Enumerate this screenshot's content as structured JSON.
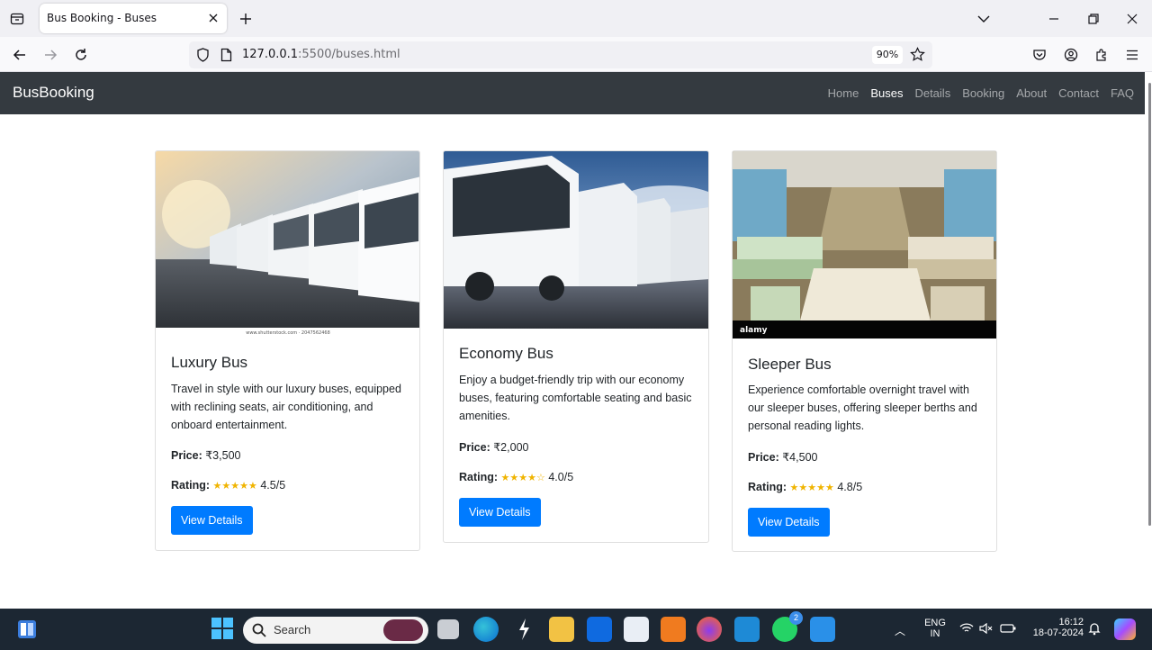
{
  "browser": {
    "tab_title": "Bus Booking - Buses",
    "url_host": "127.0.0.1",
    "url_rest": ":5500/buses.html",
    "zoom": "90%"
  },
  "site": {
    "brand": "BusBooking",
    "menu": [
      "Home",
      "Buses",
      "Details",
      "Booking",
      "About",
      "Contact",
      "FAQ"
    ],
    "active_menu": "Buses"
  },
  "cards": [
    {
      "title": "Luxury Bus",
      "description": "Travel in style with our luxury buses, equipped with reclining seats, air conditioning, and onboard entertainment.",
      "price_label": "Price:",
      "price": "₹3,500",
      "rating_label": "Rating:",
      "stars": "★★★★★",
      "rating": "4.5/5",
      "button": "View Details",
      "image_caption": "www.shutterstock.com · 2047562468"
    },
    {
      "title": "Economy Bus",
      "description": "Enjoy a budget-friendly trip with our economy buses, featuring comfortable seating and basic amenities.",
      "price_label": "Price:",
      "price": "₹2,000",
      "rating_label": "Rating:",
      "stars": "★★★★☆",
      "rating": "4.0/5",
      "button": "View Details"
    },
    {
      "title": "Sleeper Bus",
      "description": "Experience comfortable overnight travel with our sleeper buses, offering sleeper berths and personal reading lights.",
      "price_label": "Price:",
      "price": "₹4,500",
      "rating_label": "Rating:",
      "stars": "★★★★★",
      "rating": "4.8/5",
      "button": "View Details",
      "image_watermark": "alamy"
    }
  ],
  "taskbar": {
    "search": "Search",
    "lang": "ENG",
    "region": "IN",
    "time": "16:12",
    "date": "18-07-2024",
    "whatsapp_badge": "2"
  },
  "colors": {
    "primary": "#007bff",
    "navbar": "#343a40",
    "star": "#f0b400"
  }
}
